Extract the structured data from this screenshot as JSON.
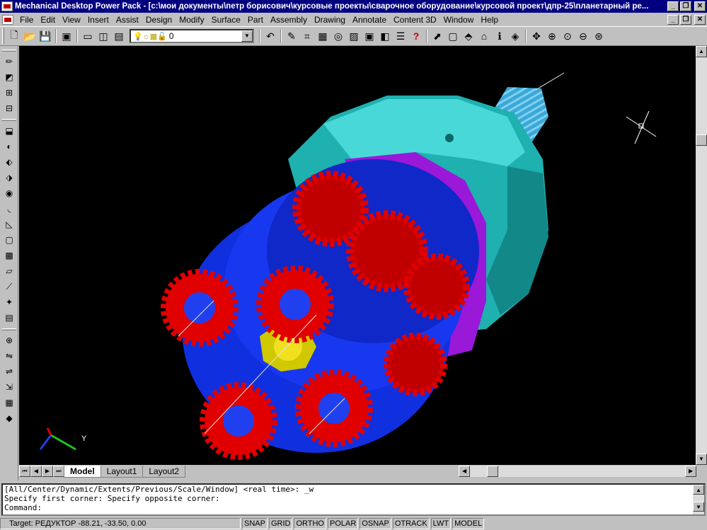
{
  "window": {
    "title": "Mechanical Desktop Power Pack - [c:\\мои документы\\петр борисович\\курсовые проекты\\сварочное оборудование\\курсовой проект\\дпр-25\\планетарный ре...",
    "minimize": "_",
    "restore": "❐",
    "close": "✕"
  },
  "menu": {
    "items": [
      "File",
      "Edit",
      "View",
      "Insert",
      "Assist",
      "Design",
      "Modify",
      "Surface",
      "Part",
      "Assembly",
      "Drawing",
      "Annotate",
      "Content 3D",
      "Window",
      "Help"
    ]
  },
  "toolbar": {
    "layer_value": "0"
  },
  "tabs": {
    "items": [
      "Model",
      "Layout1",
      "Layout2"
    ],
    "active": "Model"
  },
  "command": {
    "line1": "[All/Center/Dynamic/Extents/Previous/Scale/Window] <real time>: _w",
    "line2": "Specify first corner: Specify opposite corner:",
    "line3": "Command:"
  },
  "status": {
    "coords": "Target: РЕДУКТОР  -88.21, -33.50, 0.00",
    "buttons": [
      "SNAP",
      "GRID",
      "ORTHO",
      "POLAR",
      "OSNAP",
      "OTRACK",
      "LWT",
      "MODEL"
    ]
  },
  "ucs": {
    "y_label": "Y"
  },
  "colors": {
    "gear_red": "#e00000",
    "housing_cyan": "#22b8b8",
    "carrier_blue": "#1030e0",
    "ring_purple": "#a020e0",
    "sun_yellow": "#d8d000"
  }
}
